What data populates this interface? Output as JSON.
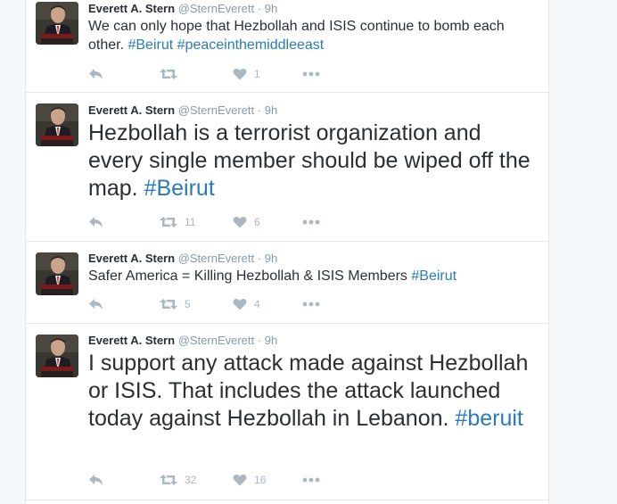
{
  "colors": {
    "hashtag": "#2b7bb9",
    "meta": "#8899a6",
    "icon": "#aab8c2"
  },
  "tweets": [
    {
      "name": "Everett A. Stern",
      "handle": "@SternEverett",
      "sep": "·",
      "time": "9h",
      "text": "We can only hope that Hezbollah and ISIS continue to bomb each other.",
      "tags": [
        "#Beirut",
        "#peaceinthemiddleeast"
      ],
      "retweets": "",
      "likes": "1"
    },
    {
      "name": "Everett A. Stern",
      "handle": "@SternEverett",
      "sep": "·",
      "time": "9h",
      "text": "Hezbollah is a terrorist organization and every single member should be wiped off the map.",
      "tags": [
        "#Beirut"
      ],
      "retweets": "11",
      "likes": "6"
    },
    {
      "name": "Everett A. Stern",
      "handle": "@SternEverett",
      "sep": "·",
      "time": "9h",
      "text": "Safer America = Killing Hezbollah & ISIS Members",
      "tags": [
        "#Beirut"
      ],
      "retweets": "5",
      "likes": "4"
    },
    {
      "name": "Everett A. Stern",
      "handle": "@SternEverett",
      "sep": "·",
      "time": "9h",
      "text": "I support any attack made against Hezbollah or ISIS. That includes the attack launched today against Hezbollah in Lebanon.",
      "tags": [
        "#beruit"
      ],
      "retweets": "32",
      "likes": "16"
    }
  ],
  "icons": {
    "avatar": "avatar-photo",
    "reply": "reply-icon",
    "retweet": "retweet-icon",
    "like": "heart-icon",
    "more": "more-dots-icon"
  }
}
